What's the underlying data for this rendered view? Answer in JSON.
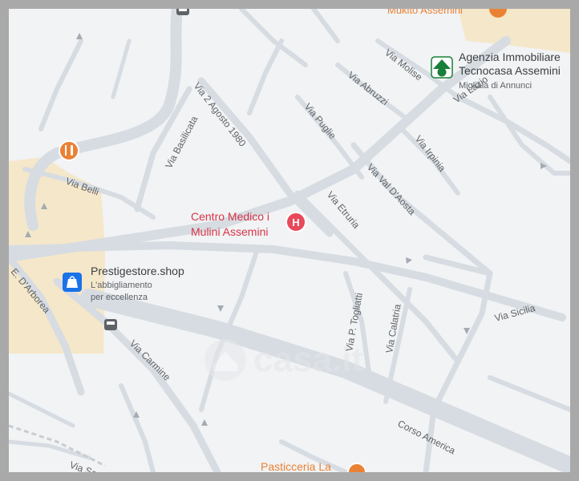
{
  "streets": {
    "via_2_agosto_1980": "Via 2 Agosto 1980",
    "via_basilicata": "Via Basilicata",
    "via_molise": "Via Molise",
    "via_abruzzi": "Via Abruzzi",
    "via_lazio": "Via Lazio",
    "via_puglie": "Via Puglie",
    "via_irpinia": "Via Irpinia",
    "via_val_daosta": "Via Val D'Aosta",
    "via_belli": "Via Belli",
    "via_etruria": "Via Etruria",
    "via_sicilia": "Via Sicilia",
    "via_p_togliatti": "Via P. Togliatti",
    "via_calatria": "Via Calatria",
    "e_darborea": "E. D'Arborea",
    "via_carmine": "Via Carmine",
    "corso_america": "Corso America",
    "via_sa": "Via Sa"
  },
  "pois": {
    "mukito": {
      "name": "Mukito Assemini",
      "icon": "restaurant-icon"
    },
    "tecnocasa": {
      "name_line1": "Agenzia Immobiliare",
      "name_line2": "Tecnocasa Assemini",
      "subtitle": "Migliaia di Annunci",
      "icon": "house-icon"
    },
    "centro_medico": {
      "name_line1": "Centro Medico i",
      "name_line2": "Mulini Assemini",
      "icon": "hospital-icon"
    },
    "prestigestore": {
      "name": "Prestigestore.shop",
      "subtitle_line1": "L'abbigliamento",
      "subtitle_line2": "per eccellenza",
      "icon": "shopping-bag-icon"
    },
    "pasticceria": {
      "name": "Pasticceria La",
      "icon": "restaurant-icon"
    },
    "restaurant_belli": {
      "icon": "restaurant-icon"
    },
    "bus_stop_top": {
      "icon": "bus-icon"
    },
    "bus_stop_left": {
      "icon": "bus-icon"
    }
  },
  "watermark": "casa.it",
  "colors": {
    "road": "#d7dde3",
    "food": "#ea8236",
    "hospital": "#e8495b",
    "poi_text_red": "#d93448",
    "shop": "#1a73e8",
    "realestate": "#188038",
    "sand": "#f5e7c9",
    "frame": "#a9a9a9"
  }
}
